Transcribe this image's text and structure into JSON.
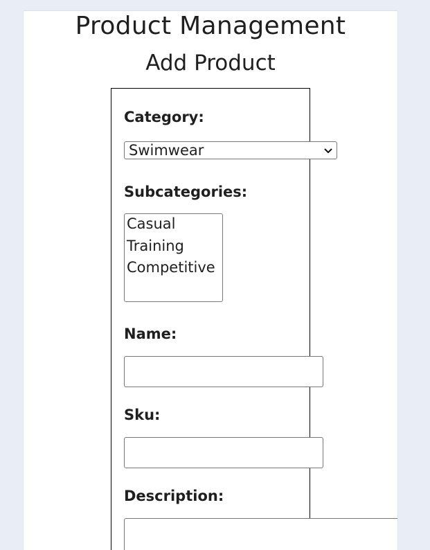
{
  "header": {
    "title": "Product Management",
    "subtitle": "Add Product"
  },
  "form": {
    "category_label": "Category:",
    "category_value": "Swimwear",
    "subcategories_label": "Subcategories:",
    "subcategories": [
      "Casual",
      "Training",
      "Competitive"
    ],
    "name_label": "Name:",
    "name_value": "",
    "sku_label": "Sku:",
    "sku_value": "",
    "description_label": "Description:",
    "description_value": ""
  }
}
